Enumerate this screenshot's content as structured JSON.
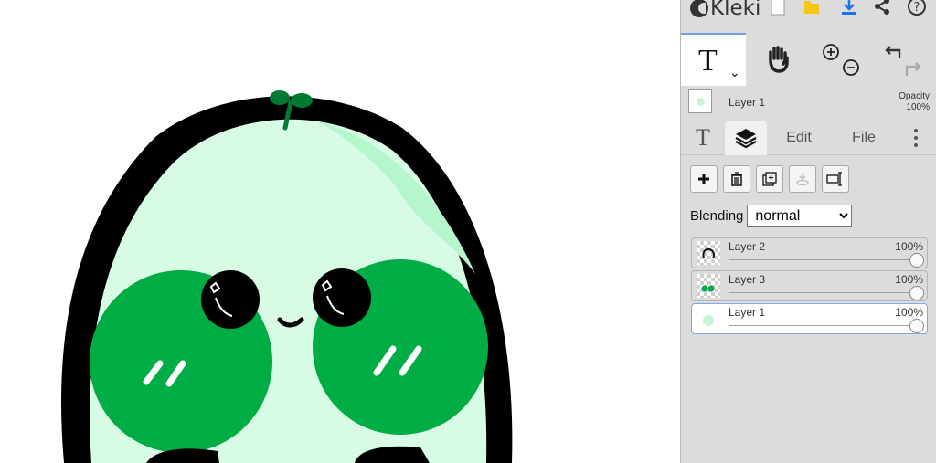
{
  "app": {
    "logo_text": "Kleki",
    "toolbar_icons": [
      "new-image-icon",
      "open-folder-icon",
      "save-download-icon",
      "share-icon",
      "help-icon"
    ],
    "accent_color": "#6fa1e6"
  },
  "tools": {
    "active_tool_glyph": "T",
    "active_tool_caret": "⌄",
    "hand_icon": "hand-icon",
    "zoom_in": "zoom-in-icon",
    "zoom_out": "zoom-out-icon",
    "undo": "undo-icon",
    "redo": "redo-icon"
  },
  "current_layer": {
    "name": "Layer 1",
    "opacity_label": "Opacity",
    "opacity_value": "100%"
  },
  "tabs": {
    "text_glyph": "T",
    "layers_icon": "layers-icon",
    "edit": "Edit",
    "file": "File",
    "more_icon": "more-vertical-icon",
    "active": "layers"
  },
  "layer_tools": [
    "add-layer-icon",
    "delete-layer-icon",
    "duplicate-layer-icon",
    "merge-down-icon",
    "rename-layer-icon"
  ],
  "blending": {
    "label": "Blending",
    "value": "normal",
    "options": [
      "normal"
    ]
  },
  "layers": [
    {
      "name": "Layer 2",
      "opacity": "100%",
      "opacity_fraction": 1.0,
      "selected": false
    },
    {
      "name": "Layer 3",
      "opacity": "100%",
      "opacity_fraction": 1.0,
      "selected": false
    },
    {
      "name": "Layer 1",
      "opacity": "100%",
      "opacity_fraction": 1.0,
      "selected": true
    }
  ],
  "canvas": {
    "colors": {
      "outline": "#000000",
      "body": "#d8fbe6",
      "highlight": "#b6f6cd",
      "cheeks": "#00ad45",
      "sprout": "#007a32",
      "eye": "#000000"
    }
  }
}
